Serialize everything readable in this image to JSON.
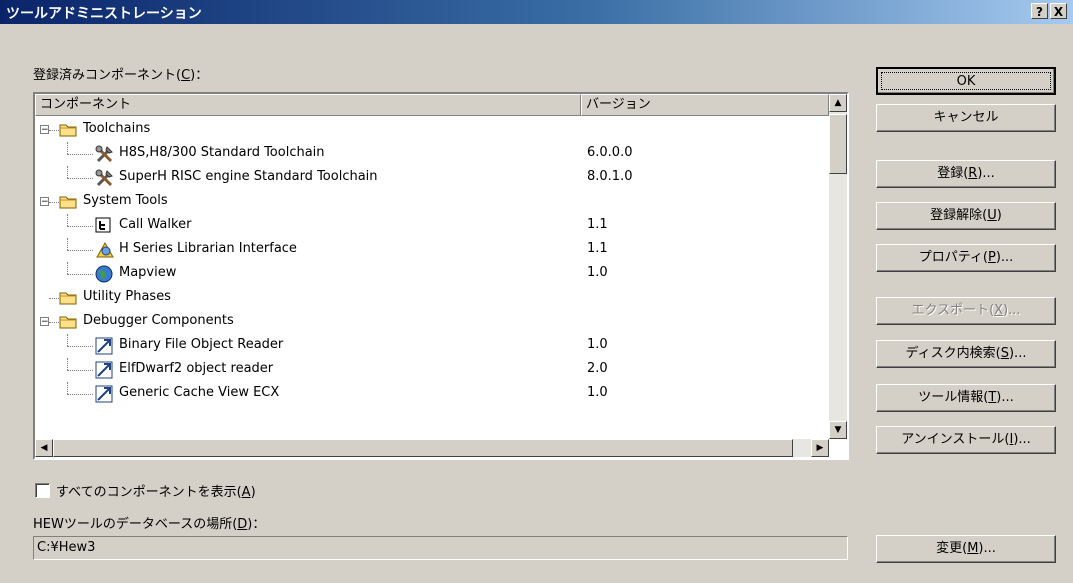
{
  "window": {
    "title": "ツールアドミニストレーション",
    "help_btn": "?",
    "close_btn": "X"
  },
  "labels": {
    "registered_prefix": "登録済みコンポーネント(",
    "registered_key": "C",
    "registered_suffix": ")：",
    "show_all_prefix": "すべてのコンポーネントを表示(",
    "show_all_key": "A",
    "show_all_suffix": ")",
    "db_prefix": "HEWツールのデータベースの場所(",
    "db_key": "D",
    "db_suffix": ")："
  },
  "columns": {
    "component": "コンポーネント",
    "version": "バージョン"
  },
  "tree": [
    {
      "name": "Toolchains",
      "version": "",
      "level": 0,
      "icon": "folder-icon",
      "expander": "−"
    },
    {
      "name": "H8S,H8/300 Standard Toolchain",
      "version": "6.0.0.0",
      "level": 1,
      "icon": "tools-icon"
    },
    {
      "name": "SuperH RISC engine Standard Toolchain",
      "version": "8.0.1.0",
      "level": 1,
      "icon": "tools-icon"
    },
    {
      "name": "System Tools",
      "version": "",
      "level": 0,
      "icon": "folder-icon",
      "expander": "−"
    },
    {
      "name": "Call Walker",
      "version": "1.1",
      "level": 1,
      "icon": "call-walker-icon"
    },
    {
      "name": "H Series Librarian Interface",
      "version": "1.1",
      "level": 1,
      "icon": "librarian-icon"
    },
    {
      "name": "Mapview",
      "version": "1.0",
      "level": 1,
      "icon": "globe-icon"
    },
    {
      "name": "Utility Phases",
      "version": "",
      "level": 0,
      "icon": "folder-icon",
      "expander": ""
    },
    {
      "name": "Debugger Components",
      "version": "",
      "level": 0,
      "icon": "folder-icon",
      "expander": "−"
    },
    {
      "name": "Binary File Object Reader",
      "version": "1.0",
      "level": 1,
      "icon": "component-icon"
    },
    {
      "name": "ElfDwarf2 object reader",
      "version": "2.0",
      "level": 1,
      "icon": "component-icon"
    },
    {
      "name": "Generic Cache View ECX",
      "version": "1.0",
      "level": 1,
      "icon": "component-icon"
    }
  ],
  "buttons": {
    "ok": "OK",
    "cancel": "キャンセル",
    "register": {
      "label": "登録(",
      "key": "R",
      "suffix": ")..."
    },
    "unregister": {
      "label": "登録解除(",
      "key": "U",
      "suffix": ")"
    },
    "properties": {
      "label": "プロパティ(",
      "key": "P",
      "suffix": ")..."
    },
    "export": {
      "label": "エクスポート(",
      "key": "X",
      "suffix": ")..."
    },
    "search": {
      "label": "ディスク内検索(",
      "key": "S",
      "suffix": ")..."
    },
    "toolinfo": {
      "label": "ツール情報(",
      "key": "T",
      "suffix": ")..."
    },
    "uninstall": {
      "label": "アンインストール(",
      "key": "I",
      "suffix": ")..."
    },
    "change": {
      "label": "変更(",
      "key": "M",
      "suffix": ")..."
    }
  },
  "db_path": "C:¥Hew3"
}
